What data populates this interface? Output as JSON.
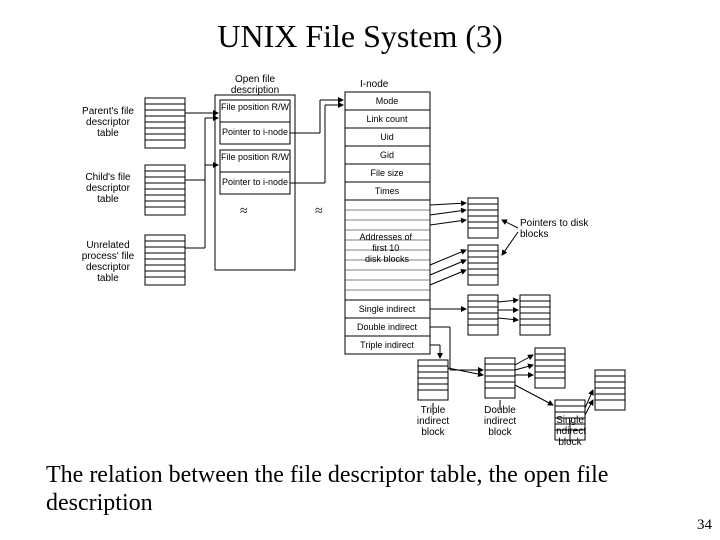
{
  "title": "UNIX File System (3)",
  "caption": "The relation between the file descriptor table, the open file description",
  "page_number": "34",
  "fd_tables": {
    "parent": "Parent's file descriptor table",
    "child": "Child's file descriptor table",
    "unrelated": "Unrelated process' file descriptor table"
  },
  "ofd": {
    "header": "Open file description",
    "entry1a": "File position R/W",
    "entry1b": "Pointer to i-node",
    "entry2a": "File position R/W",
    "entry2b": "Pointer to i-node"
  },
  "inode": {
    "header": "I-node",
    "mode": "Mode",
    "link": "Link count",
    "uid": "Uid",
    "gid": "Gid",
    "size": "File size",
    "times": "Times",
    "direct": "Addresses of first 10 disk blocks",
    "single": "Single indirect",
    "double": "Double indirect",
    "triple": "Triple indirect"
  },
  "pointers_label": "Pointers to disk blocks",
  "triple_block": "Triple indirect block",
  "double_block": "Double indirect block",
  "single_block": "Single indirect block"
}
